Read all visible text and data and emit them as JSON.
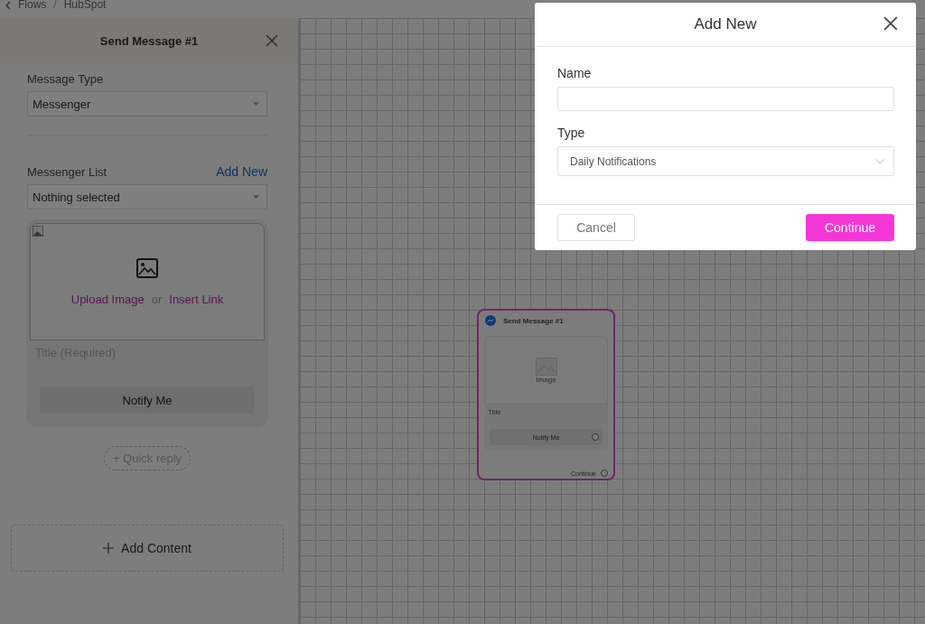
{
  "breadcrumb": {
    "items": [
      "Flows",
      "HubSpot"
    ],
    "separator": "/"
  },
  "panel": {
    "title": "Send Message #1",
    "message_type": {
      "label": "Message Type",
      "value": "Messenger"
    },
    "messenger_list": {
      "label": "Messenger List",
      "link": "Add New",
      "value": "Nothing selected"
    },
    "card": {
      "upload": "Upload Image",
      "or": "or",
      "insert": "Insert Link",
      "title_placeholder": "Title (Required)",
      "button": "Notify Me"
    },
    "quick_reply": "+ Quick reply",
    "add_content": "Add Content"
  },
  "node": {
    "title": "Send Message #1",
    "image_label": "Image",
    "title_placeholder": "Title",
    "button": "Notify Me",
    "continue": "Continue",
    "selected": true
  },
  "modal": {
    "title": "Add New",
    "fields": [
      {
        "kind": "text",
        "label": "Name"
      },
      {
        "kind": "select",
        "label": "Type",
        "value": "Daily Notifications"
      }
    ],
    "cancel": "Cancel",
    "continue": "Continue"
  }
}
